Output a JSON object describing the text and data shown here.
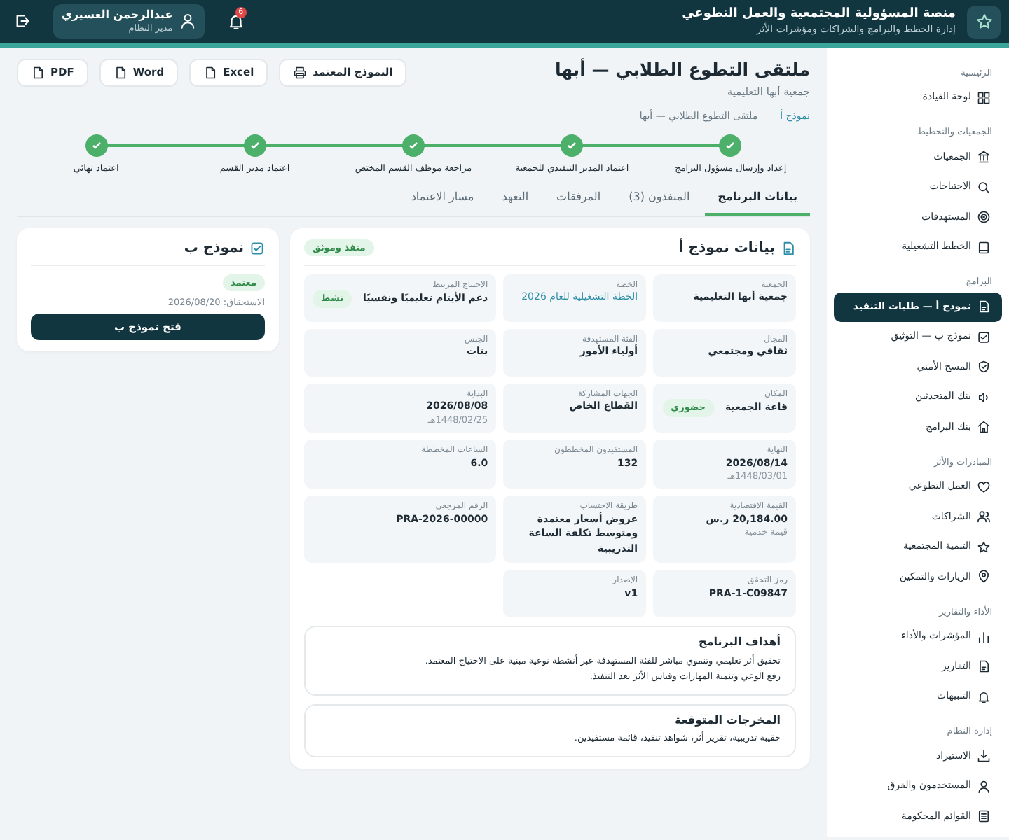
{
  "header": {
    "title": "منصة المسؤولية المجتمعية والعمل التطوعي",
    "subtitle": "إدارة الخطط والبرامج والشراكات ومؤشرات الأثر",
    "notifications": "6",
    "user": {
      "name": "عبدالرحمن العسيري",
      "role": "مدير النظام"
    }
  },
  "sidebar": [
    {
      "heading": "الرئيسية",
      "items": [
        {
          "label": "لوحة القيادة",
          "selected": false
        }
      ]
    },
    {
      "heading": "الجمعيات والتخطيط",
      "items": [
        {
          "label": "الجمعيات",
          "selected": false
        },
        {
          "label": "الاحتياجات",
          "selected": false
        },
        {
          "label": "المستهدفات",
          "selected": false
        },
        {
          "label": "الخطط التشغيلية",
          "selected": false
        }
      ]
    },
    {
      "heading": "البرامج",
      "items": [
        {
          "label": "نموذج أ — طلبات التنفيذ",
          "selected": true
        },
        {
          "label": "نموذج ب — التوثيق",
          "selected": false
        },
        {
          "label": "المسح الأمني",
          "selected": false
        },
        {
          "label": "بنك المتحدثين",
          "selected": false
        },
        {
          "label": "بنك البرامج",
          "selected": false
        }
      ]
    },
    {
      "heading": "المبادرات والأثر",
      "items": [
        {
          "label": "العمل التطوعي",
          "selected": false
        },
        {
          "label": "الشراكات",
          "selected": false
        },
        {
          "label": "التنمية المجتمعية",
          "selected": false
        },
        {
          "label": "الزيارات والتمكين",
          "selected": false
        }
      ]
    },
    {
      "heading": "الأداء والتقارير",
      "items": [
        {
          "label": "المؤشرات والأداء",
          "selected": false
        },
        {
          "label": "التقارير",
          "selected": false
        },
        {
          "label": "التنبيهات",
          "selected": false
        }
      ]
    },
    {
      "heading": "إدارة النظام",
      "items": [
        {
          "label": "الاستيراد",
          "selected": false
        },
        {
          "label": "المستخدمون والفرق",
          "selected": false
        },
        {
          "label": "القوائم المحكومة",
          "selected": false
        }
      ]
    }
  ],
  "page": {
    "title": "ملتقى التطوع الطلابي — أبها",
    "subtitle": "جمعية أبها التعليمية",
    "breadcrumb": [
      {
        "label": "نموذج أ",
        "kind": "link"
      },
      {
        "label": "ملتقى التطوع الطلابي — أبها",
        "kind": "current"
      }
    ],
    "exports": [
      {
        "label": "النموذج المعتمد",
        "kind": "print"
      },
      {
        "label": "Excel",
        "kind": "file"
      },
      {
        "label": "Word",
        "kind": "file"
      },
      {
        "label": "PDF",
        "kind": "file"
      }
    ]
  },
  "steps": [
    {
      "label": "إعداد وإرسال مسؤول البرامج",
      "done": true
    },
    {
      "label": "اعتماد المدير التنفيذي للجمعية",
      "done": true
    },
    {
      "label": "مراجعة موظف القسم المختص",
      "done": true
    },
    {
      "label": "اعتماد مدير القسم",
      "done": true
    },
    {
      "label": "اعتماد نهائي",
      "done": true
    }
  ],
  "tabs": [
    {
      "label": "بيانات البرنامج",
      "selected": true
    },
    {
      "label": "المنفذون (3)",
      "selected": false
    },
    {
      "label": "المرفقات",
      "selected": false
    },
    {
      "label": "التعهد",
      "selected": false
    },
    {
      "label": "مسار الاعتماد",
      "selected": false
    }
  ],
  "form_a": {
    "title": "بيانات نموذج أ",
    "status": "منفذ وموثق",
    "fields": [
      {
        "label": "الجمعية",
        "value": "جمعية أبها التعليمية",
        "kind": "text"
      },
      {
        "label": "الخطة",
        "value": "الخطة التشغيلية للعام 2026",
        "kind": "link"
      },
      {
        "label": "الاحتياج المرتبط",
        "value": "دعم الأيتام تعليميًا ونفسيًا",
        "kind": "text",
        "tag": "نشط"
      },
      {
        "label": "المجال",
        "value": "ثقافي ومجتمعي",
        "kind": "text"
      },
      {
        "label": "الفئة المستهدفة",
        "value": "أولياء الأمور",
        "kind": "text"
      },
      {
        "label": "الجنس",
        "value": "بنات",
        "kind": "text"
      },
      {
        "label": "المكان",
        "value": "قاعة الجمعية",
        "kind": "text",
        "tag": "حضوري"
      },
      {
        "label": "الجهات المشاركة",
        "value": "القطاع الخاص",
        "kind": "text"
      },
      {
        "label": "البداية",
        "value": "2026/08/08",
        "kind": "text",
        "sub": "1448/02/25هـ"
      },
      {
        "label": "النهاية",
        "value": "2026/08/14",
        "kind": "text",
        "sub": "1448/03/01هـ"
      },
      {
        "label": "المستفيدون المخططون",
        "value": "132",
        "kind": "text"
      },
      {
        "label": "الساعات المخططة",
        "value": "6.0",
        "kind": "text"
      },
      {
        "label": "القيمة الاقتصادية",
        "value": "20,184.00 ر.س",
        "kind": "text",
        "sub": "قيمة خدمية"
      },
      {
        "label": "طريقة الاحتساب",
        "value": "عروض أسعار معتمدة ومتوسط تكلفة الساعة التدريبية",
        "kind": "text"
      },
      {
        "label": "الرقم المرجعي",
        "value": "PRA-2026-00000",
        "kind": "text"
      },
      {
        "label": "رمز التحقق",
        "value": "PRA-1-C09847",
        "kind": "text"
      },
      {
        "label": "الإصدار",
        "value": "v1",
        "kind": "text"
      }
    ],
    "sections": [
      {
        "title": "أهداف البرنامج",
        "lines": [
          "تحقيق أثر تعليمي وتنموي مباشر للفئة المستهدفة عبر أنشطة نوعية مبنية على الاحتياج المعتمد.",
          "رفع الوعي وتنمية المهارات وقياس الأثر بعد التنفيذ."
        ]
      },
      {
        "title": "المخرجات المتوقعة",
        "lines": [
          "حقيبة تدريبية، تقرير أثر، شواهد تنفيذ، قائمة مستفيدين."
        ]
      }
    ]
  },
  "form_b": {
    "title": "نموذج ب",
    "status": "معتمد",
    "due": "الاستحقاق: 2026/08/20",
    "button": "فتح نموذج ب"
  }
}
